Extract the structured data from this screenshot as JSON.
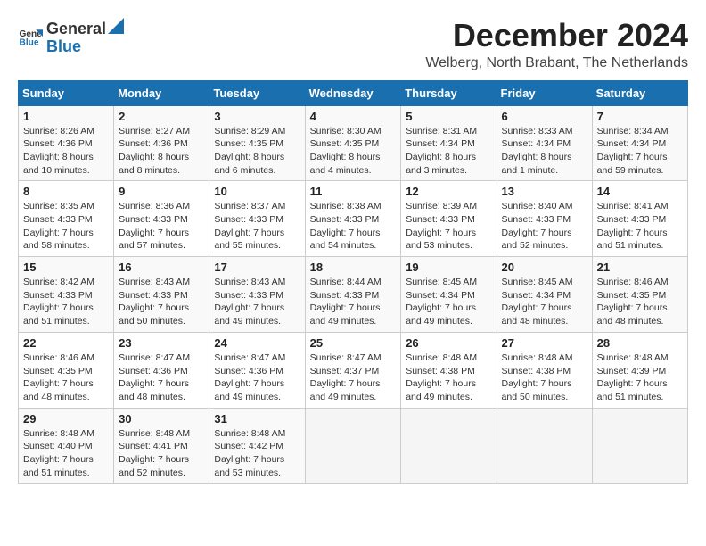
{
  "logo": {
    "general": "General",
    "blue": "Blue"
  },
  "header": {
    "month": "December 2024",
    "location": "Welberg, North Brabant, The Netherlands"
  },
  "weekdays": [
    "Sunday",
    "Monday",
    "Tuesday",
    "Wednesday",
    "Thursday",
    "Friday",
    "Saturday"
  ],
  "weeks": [
    [
      {
        "day": "1",
        "sunrise": "8:26 AM",
        "sunset": "4:36 PM",
        "daylight": "8 hours and 10 minutes."
      },
      {
        "day": "2",
        "sunrise": "8:27 AM",
        "sunset": "4:36 PM",
        "daylight": "8 hours and 8 minutes."
      },
      {
        "day": "3",
        "sunrise": "8:29 AM",
        "sunset": "4:35 PM",
        "daylight": "8 hours and 6 minutes."
      },
      {
        "day": "4",
        "sunrise": "8:30 AM",
        "sunset": "4:35 PM",
        "daylight": "8 hours and 4 minutes."
      },
      {
        "day": "5",
        "sunrise": "8:31 AM",
        "sunset": "4:34 PM",
        "daylight": "8 hours and 3 minutes."
      },
      {
        "day": "6",
        "sunrise": "8:33 AM",
        "sunset": "4:34 PM",
        "daylight": "8 hours and 1 minute."
      },
      {
        "day": "7",
        "sunrise": "8:34 AM",
        "sunset": "4:34 PM",
        "daylight": "7 hours and 59 minutes."
      }
    ],
    [
      {
        "day": "8",
        "sunrise": "8:35 AM",
        "sunset": "4:33 PM",
        "daylight": "7 hours and 58 minutes."
      },
      {
        "day": "9",
        "sunrise": "8:36 AM",
        "sunset": "4:33 PM",
        "daylight": "7 hours and 57 minutes."
      },
      {
        "day": "10",
        "sunrise": "8:37 AM",
        "sunset": "4:33 PM",
        "daylight": "7 hours and 55 minutes."
      },
      {
        "day": "11",
        "sunrise": "8:38 AM",
        "sunset": "4:33 PM",
        "daylight": "7 hours and 54 minutes."
      },
      {
        "day": "12",
        "sunrise": "8:39 AM",
        "sunset": "4:33 PM",
        "daylight": "7 hours and 53 minutes."
      },
      {
        "day": "13",
        "sunrise": "8:40 AM",
        "sunset": "4:33 PM",
        "daylight": "7 hours and 52 minutes."
      },
      {
        "day": "14",
        "sunrise": "8:41 AM",
        "sunset": "4:33 PM",
        "daylight": "7 hours and 51 minutes."
      }
    ],
    [
      {
        "day": "15",
        "sunrise": "8:42 AM",
        "sunset": "4:33 PM",
        "daylight": "7 hours and 51 minutes."
      },
      {
        "day": "16",
        "sunrise": "8:43 AM",
        "sunset": "4:33 PM",
        "daylight": "7 hours and 50 minutes."
      },
      {
        "day": "17",
        "sunrise": "8:43 AM",
        "sunset": "4:33 PM",
        "daylight": "7 hours and 49 minutes."
      },
      {
        "day": "18",
        "sunrise": "8:44 AM",
        "sunset": "4:33 PM",
        "daylight": "7 hours and 49 minutes."
      },
      {
        "day": "19",
        "sunrise": "8:45 AM",
        "sunset": "4:34 PM",
        "daylight": "7 hours and 49 minutes."
      },
      {
        "day": "20",
        "sunrise": "8:45 AM",
        "sunset": "4:34 PM",
        "daylight": "7 hours and 48 minutes."
      },
      {
        "day": "21",
        "sunrise": "8:46 AM",
        "sunset": "4:35 PM",
        "daylight": "7 hours and 48 minutes."
      }
    ],
    [
      {
        "day": "22",
        "sunrise": "8:46 AM",
        "sunset": "4:35 PM",
        "daylight": "7 hours and 48 minutes."
      },
      {
        "day": "23",
        "sunrise": "8:47 AM",
        "sunset": "4:36 PM",
        "daylight": "7 hours and 48 minutes."
      },
      {
        "day": "24",
        "sunrise": "8:47 AM",
        "sunset": "4:36 PM",
        "daylight": "7 hours and 49 minutes."
      },
      {
        "day": "25",
        "sunrise": "8:47 AM",
        "sunset": "4:37 PM",
        "daylight": "7 hours and 49 minutes."
      },
      {
        "day": "26",
        "sunrise": "8:48 AM",
        "sunset": "4:38 PM",
        "daylight": "7 hours and 49 minutes."
      },
      {
        "day": "27",
        "sunrise": "8:48 AM",
        "sunset": "4:38 PM",
        "daylight": "7 hours and 50 minutes."
      },
      {
        "day": "28",
        "sunrise": "8:48 AM",
        "sunset": "4:39 PM",
        "daylight": "7 hours and 51 minutes."
      }
    ],
    [
      {
        "day": "29",
        "sunrise": "8:48 AM",
        "sunset": "4:40 PM",
        "daylight": "7 hours and 51 minutes."
      },
      {
        "day": "30",
        "sunrise": "8:48 AM",
        "sunset": "4:41 PM",
        "daylight": "7 hours and 52 minutes."
      },
      {
        "day": "31",
        "sunrise": "8:48 AM",
        "sunset": "4:42 PM",
        "daylight": "7 hours and 53 minutes."
      },
      null,
      null,
      null,
      null
    ]
  ]
}
